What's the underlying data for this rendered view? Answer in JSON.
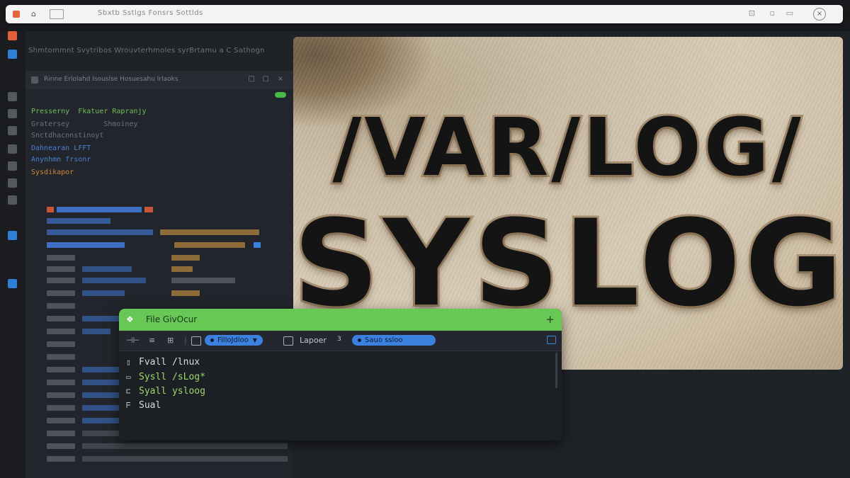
{
  "browser": {
    "url_text": "Sbxtb  Sstlgs  Fonsrs  Sottlds"
  },
  "left_header": {
    "text": "Shmtommnt Svytribos  Wrouvterhmoles     syrBrtamu  a  C Sathogn"
  },
  "editor": {
    "title": "Rinne  Erlolahd  Isouslse        Hosuesahu  Irlaoks",
    "lines": [
      "Presserny  Fkatuer Rapranjy",
      "Gratersey        Shmoiney",
      "Snctdhacnnstinoyt",
      "Dahnearan LFFT",
      "Anynhmn frsonr",
      "Sysdikapor"
    ]
  },
  "hero": {
    "line1": "/VAR/LOG/",
    "line2": "SYSLOG"
  },
  "file_browser": {
    "title": "File GivOcur",
    "toolbar": {
      "chip1": "FilloJdloo",
      "label": "Lapoer",
      "count": "3",
      "chip2": "Sauo ssloo"
    },
    "rows": [
      {
        "icon": "folder-icon",
        "text": "Fvall /lnux",
        "highlight": false
      },
      {
        "icon": "file-icon",
        "text": "Sysll /sLog*",
        "highlight": true
      },
      {
        "icon": "file-icon",
        "text": "Syall ysloog",
        "highlight": true
      },
      {
        "icon": "file-icon",
        "text": "Sual",
        "highlight": false
      }
    ]
  },
  "colors": {
    "accent_green": "#67c856",
    "accent_blue": "#3b82e0",
    "background": "#1f2227"
  }
}
